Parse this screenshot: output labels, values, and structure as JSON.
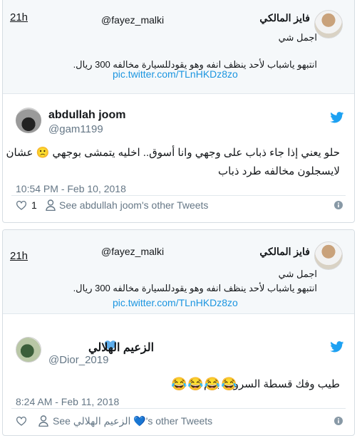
{
  "embeds": [
    {
      "quote": {
        "time_label": "21h",
        "handle": "@fayez_malki",
        "name": "فايز المالكي",
        "text_line1": "اجمل شي",
        "text_line2": "انتبهو ياشباب لأحد ينظف انفه وهو يقودللسيارة مخالفه 300 ريال.",
        "link": "pic.twitter.com/TLnHKDz8zo"
      },
      "reply": {
        "name": "abdullah joom",
        "handle": "@gam1199",
        "text_line1": "حلو يعني إذا جاء ذباب على وجهي وانا أسوق.. اخليه يتمشى بوجهي 🙁 عشان",
        "text_line2": "لايسجلون مخالفه طرد ذباب",
        "date": "10:54 PM - Feb 10, 2018",
        "like_count": "1",
        "see_tweets": "See abdullah joom's other Tweets"
      }
    },
    {
      "quote": {
        "time_label": "21h",
        "handle": "@fayez_malki",
        "name": "فايز المالكي",
        "text_line1": "اجمل شي",
        "text_line2": "انتبهو ياشباب لأحد ينظف انفه وهو يقودللسيارة مخالفه 300 ريال.",
        "link": "pic.twitter.com/TLnHKDz8zo"
      },
      "reply": {
        "name": "الزعيم الهلالي",
        "handle": "@Dior_2019",
        "text_line1": "طيب وفك قسطة السروال بكم",
        "emojis": "😂😂😂😂",
        "date": "8:24 AM - Feb 11, 2018",
        "see_tweets": "See الزعيم الهلالي 💙's other Tweets"
      }
    }
  ],
  "icons": {
    "twitter_bird": "twitter-bird-icon",
    "like": "heart-outline-icon",
    "person": "person-icon",
    "info": "info-icon",
    "blue_heart": "blue-heart-icon"
  },
  "colors": {
    "link": "#1b95e0",
    "twitter_blue": "#1da1f2",
    "muted": "#657786",
    "quote_bg": "#f5f8fa",
    "border": "#d6dde3"
  }
}
